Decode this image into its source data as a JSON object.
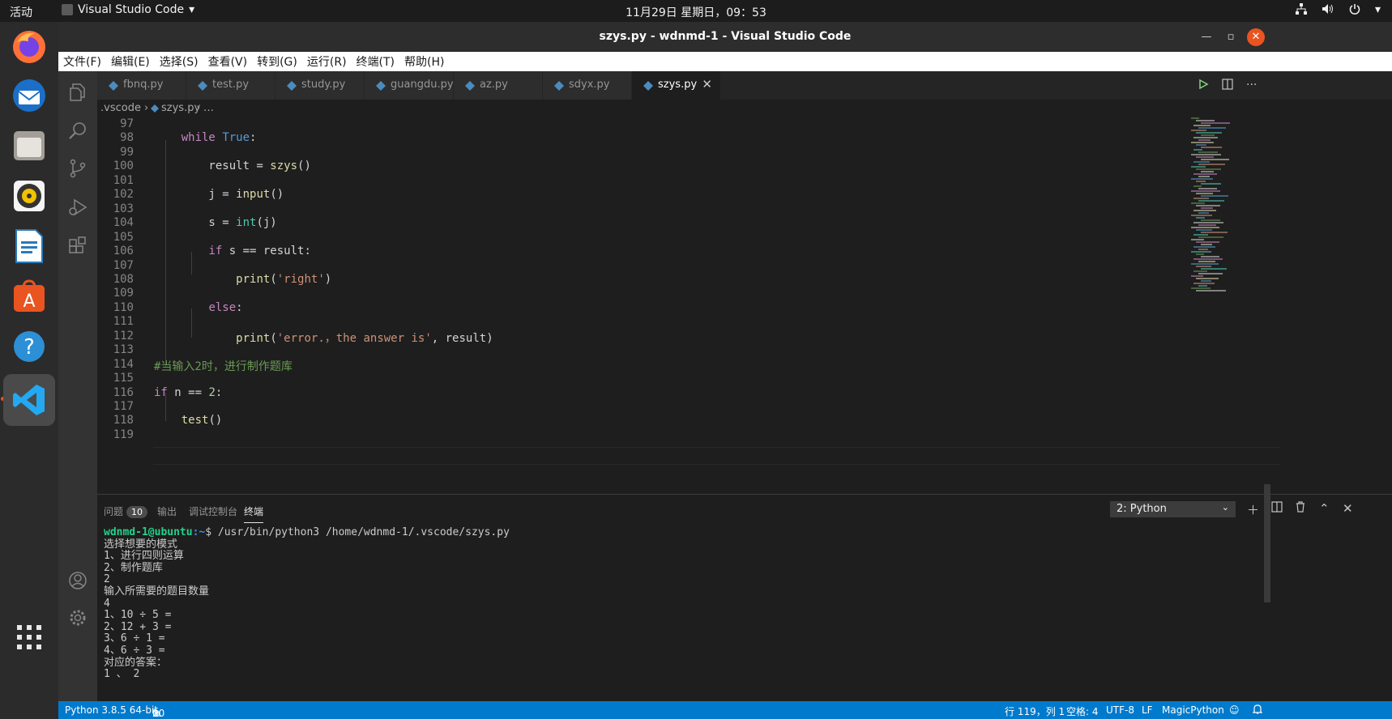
{
  "gnome": {
    "activities": "活动",
    "app_name": "Visual Studio Code",
    "clock": "11月29日 星期日，09：53"
  },
  "window": {
    "title": "szys.py - wdnmd-1 - Visual Studio Code"
  },
  "menu": [
    "文件(F)",
    "编辑(E)",
    "选择(S)",
    "查看(V)",
    "转到(G)",
    "运行(R)",
    "终端(T)",
    "帮助(H)"
  ],
  "tabs": [
    {
      "label": "fbnq.py"
    },
    {
      "label": "test.py"
    },
    {
      "label": "study.py"
    },
    {
      "label": "guangdu.py"
    },
    {
      "label": "az.py"
    },
    {
      "label": "sdyx.py"
    },
    {
      "label": "szys.py",
      "active": true
    }
  ],
  "breadcrumb": {
    "folder": ".vscode",
    "file": "szys.py",
    "more": "…"
  },
  "editor": {
    "lines": [
      {
        "n": "97",
        "tokens": []
      },
      {
        "n": "98",
        "tokens": [
          [
            "",
            "    "
          ],
          [
            "kw",
            "while"
          ],
          [
            "",
            " "
          ],
          [
            "bi",
            "True"
          ],
          [
            "",
            ":"
          ]
        ]
      },
      {
        "n": "99",
        "tokens": []
      },
      {
        "n": "100",
        "tokens": [
          [
            "",
            "        result = "
          ],
          [
            "fn",
            "szys"
          ],
          [
            "",
            "()"
          ]
        ]
      },
      {
        "n": "101",
        "tokens": []
      },
      {
        "n": "102",
        "tokens": [
          [
            "",
            "        j = "
          ],
          [
            "fn",
            "input"
          ],
          [
            "",
            "()"
          ]
        ]
      },
      {
        "n": "103",
        "tokens": []
      },
      {
        "n": "104",
        "tokens": [
          [
            "",
            "        s = "
          ],
          [
            "builtin",
            "int"
          ],
          [
            "",
            "(j)"
          ]
        ]
      },
      {
        "n": "105",
        "tokens": []
      },
      {
        "n": "106",
        "tokens": [
          [
            "",
            "        "
          ],
          [
            "kw",
            "if"
          ],
          [
            "",
            " s == result:"
          ]
        ]
      },
      {
        "n": "107",
        "tokens": []
      },
      {
        "n": "108",
        "tokens": [
          [
            "",
            "            "
          ],
          [
            "fn",
            "print"
          ],
          [
            "",
            "("
          ],
          [
            "str",
            "'right'"
          ],
          [
            "",
            ")"
          ]
        ]
      },
      {
        "n": "109",
        "tokens": []
      },
      {
        "n": "110",
        "tokens": [
          [
            "",
            "        "
          ],
          [
            "kw",
            "else"
          ],
          [
            "",
            ":"
          ]
        ]
      },
      {
        "n": "111",
        "tokens": []
      },
      {
        "n": "112",
        "tokens": [
          [
            "",
            "            "
          ],
          [
            "fn",
            "print"
          ],
          [
            "",
            "("
          ],
          [
            "str",
            "'error.，the answer is'"
          ],
          [
            "",
            ", result)"
          ]
        ]
      },
      {
        "n": "113",
        "tokens": []
      },
      {
        "n": "114",
        "tokens": [
          [
            "cmt",
            "#当输入2时，进行制作题库"
          ]
        ]
      },
      {
        "n": "115",
        "tokens": []
      },
      {
        "n": "116",
        "tokens": [
          [
            "kw",
            "if"
          ],
          [
            "",
            " n == "
          ],
          [
            "num",
            "2"
          ],
          [
            "",
            ":"
          ]
        ]
      },
      {
        "n": "117",
        "tokens": []
      },
      {
        "n": "118",
        "tokens": [
          [
            "",
            "    "
          ],
          [
            "fn",
            "test"
          ],
          [
            "",
            "()"
          ]
        ]
      },
      {
        "n": "119",
        "tokens": []
      }
    ]
  },
  "panel": {
    "tabs": {
      "problems": "问题",
      "problems_count": "10",
      "output": "输出",
      "debug": "调试控制台",
      "terminal": "终端"
    },
    "terminal_select": "2: Python",
    "terminal": {
      "prompt_user": "wdnmd-1@ubuntu",
      "prompt_path": ":~",
      "command": "$ /usr/bin/python3 /home/wdnmd-1/.vscode/szys.py",
      "lines": [
        "选择想要的模式",
        "1、进行四则运算",
        "2、制作题库",
        "2",
        "输入所需要的题目数量",
        "4",
        "1、10 ÷ 5 =",
        "2、12 + 3 =",
        "3、6 ÷ 1 =",
        "4、6 ÷ 3 =",
        "对应的答案：",
        "1 、 2"
      ]
    }
  },
  "status": {
    "python": "Python 3.8.5 64-bit",
    "errors": "0",
    "warnings": "10",
    "position": "行 119，列 1",
    "spaces": "空格: 4",
    "encoding": "UTF-8",
    "eol": "LF",
    "language": "MagicPython"
  }
}
